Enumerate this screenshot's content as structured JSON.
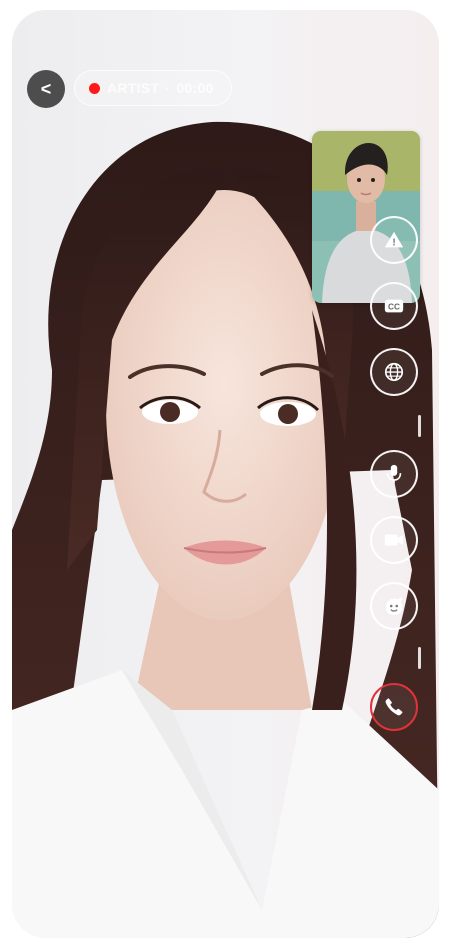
{
  "status": {
    "back_label": "<",
    "caller_name": "ARTIST",
    "separator": "·",
    "elapsed": "00:00"
  },
  "controls": {
    "report_label": "!",
    "captions_label": "CC"
  },
  "colors": {
    "recording": "#ff1a1a",
    "end_call": "#e0323b"
  }
}
